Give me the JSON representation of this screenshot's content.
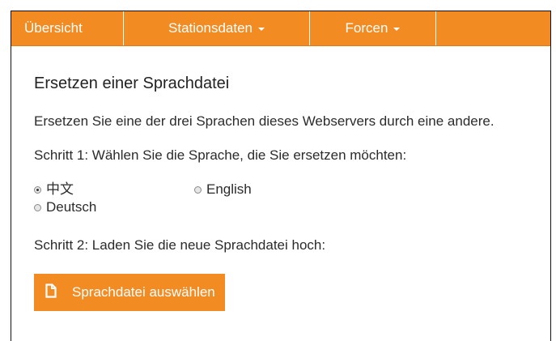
{
  "nav": {
    "items": [
      {
        "label": "Übersicht"
      },
      {
        "label": "Stationsdaten"
      },
      {
        "label": "Forcen"
      }
    ]
  },
  "main": {
    "title": "Ersetzen einer Sprachdatei",
    "description": "Ersetzen Sie eine der drei Sprachen dieses Webservers durch eine andere.",
    "step1": "Schritt 1: Wählen Sie die Sprache, die Sie ersetzen möchten:",
    "languages": [
      {
        "label": "中文",
        "checked": true
      },
      {
        "label": "English",
        "checked": false
      },
      {
        "label": "Deutsch",
        "checked": false
      }
    ],
    "step2": "Schritt 2: Laden Sie die neue Sprachdatei hoch:",
    "upload_button": "Sprachdatei auswählen"
  },
  "colors": {
    "accent": "#f28b22",
    "text": "#2b2b2b"
  },
  "icons": {
    "upload": "file-icon",
    "dropdown": "caret-down-icon"
  }
}
